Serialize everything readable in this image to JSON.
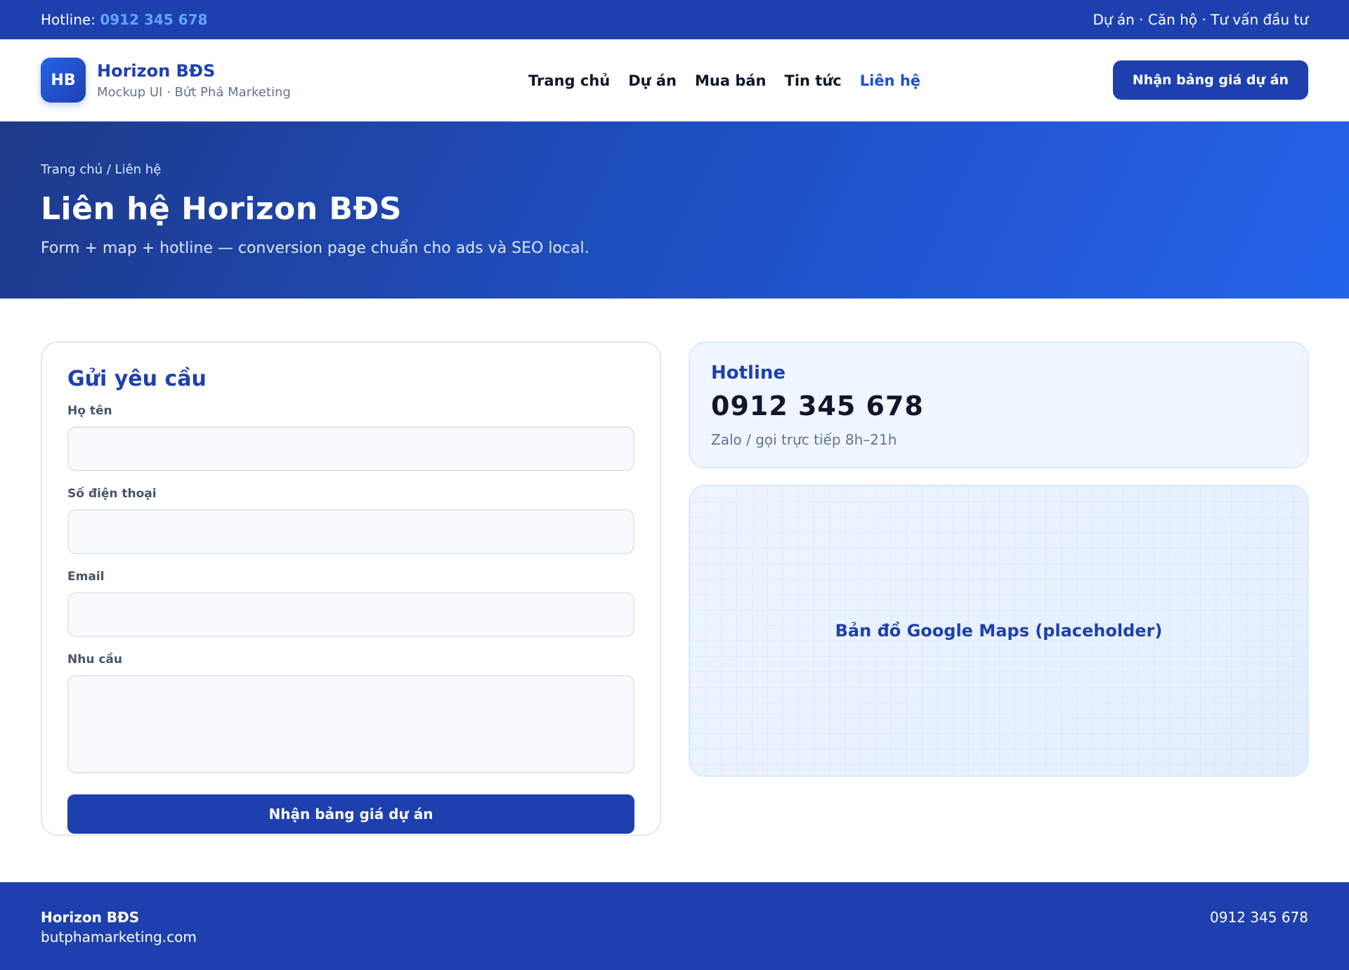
{
  "topbar": {
    "hotline_label": "Hotline: ",
    "hotline_number": "0912 345 678",
    "right_text": "Dự án · Căn hộ · Tư vấn đầu tư"
  },
  "header": {
    "logo_initials": "HB",
    "brand_name": "Horizon BĐS",
    "brand_sub": "Mockup UI · Bứt Phá Marketing",
    "nav": [
      "Trang chủ",
      "Dự án",
      "Mua bán",
      "Tin tức",
      "Liên hệ"
    ],
    "active_nav": "Liên hệ",
    "cta_label": "Nhận bảng giá dự án"
  },
  "hero": {
    "breadcrumb": "Trang chủ / Liên hệ",
    "title": "Liên hệ Horizon BĐS",
    "subtitle": "Form + map + hotline — conversion page chuẩn cho ads và SEO local."
  },
  "form": {
    "title": "Gửi yêu cầu",
    "fields": [
      {
        "label": "Họ tên",
        "value": "",
        "placeholder": ""
      },
      {
        "label": "Số điện thoại",
        "value": "",
        "placeholder": ""
      },
      {
        "label": "Email",
        "value": "",
        "placeholder": ""
      },
      {
        "label": "Nhu cầu",
        "value": "",
        "placeholder": ""
      }
    ],
    "submit_label": "Nhận bảng giá dự án"
  },
  "hotline_card": {
    "label": "Hotline",
    "number": "0912 345 678",
    "note": "Zalo / gọi trực tiếp 8h–21h"
  },
  "map": {
    "label": "Bản đồ Google Maps (placeholder)"
  },
  "footer": {
    "brand": "Horizon BĐS",
    "site": "butphamarketing.com",
    "phone": "0912 345 678"
  },
  "colors": {
    "primary": "#1e40af",
    "accent_light": "#60a5fa",
    "card_bg": "#eff6ff"
  }
}
